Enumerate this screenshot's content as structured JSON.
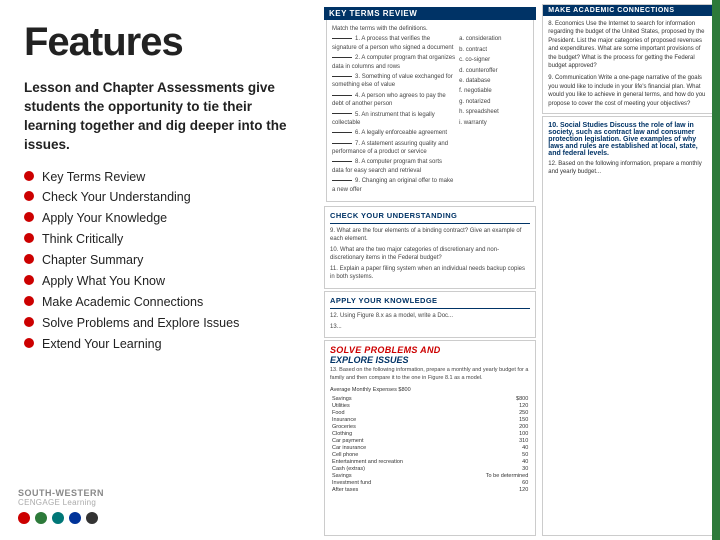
{
  "title": "Features",
  "intro": "Lesson and Chapter Assessments give students the opportunity to tie their learning together and dig deeper into the issues.",
  "bullets": [
    {
      "label": "Key Terms Review"
    },
    {
      "label": "Check Your Understanding"
    },
    {
      "label": "Apply Your Knowledge"
    },
    {
      "label": "Think Critically"
    },
    {
      "label": "Chapter Summary"
    },
    {
      "label": "Apply What You Know"
    },
    {
      "label": "Make Academic Connections"
    },
    {
      "label": "Solve Problems and Explore Issues"
    },
    {
      "label": "Extend Your Learning"
    }
  ],
  "logo": {
    "top": "SOUTH-WESTERN",
    "bottom": "CENGAGE Learning"
  },
  "colors": {
    "red": "#cc0000",
    "green": "#2d7a3a",
    "teal": "#007777",
    "blue": "#003399",
    "dark": "#222222",
    "dots": [
      "#cc0000",
      "#007744",
      "#007777",
      "#003399",
      "#333333"
    ]
  },
  "keyTerms": {
    "header": "KEY TERMS REVIEW",
    "instruction": "Match the terms with the definitions.",
    "items": [
      {
        "num": "1.",
        "text": "A process that verifies the signature of a person who signed a document"
      },
      {
        "num": "2.",
        "text": "A computer program that organizes data in columns and rows"
      },
      {
        "num": "3.",
        "text": "Something of value exchanged for something else of value"
      },
      {
        "num": "4.",
        "text": "A person who agrees to pay the debt of another person"
      },
      {
        "num": "5.",
        "text": "An instrument that is legally collectable"
      },
      {
        "num": "6.",
        "text": "A legally enforceable agreement"
      },
      {
        "num": "7.",
        "text": "A statement assuring quality and performance of a product or service"
      },
      {
        "num": "8.",
        "text": "A computer program that sorts data for easy search and retrieval"
      },
      {
        "num": "9.",
        "text": "Changing an original offer to make a new offer"
      }
    ],
    "answers": [
      "a. consideration",
      "b. contract",
      "c. co-signer",
      "d. counteroffer",
      "e. database",
      "f. negotiable",
      "g. notarized",
      "h. spreadsheet",
      "i. warranty"
    ]
  },
  "checkUnderstanding": {
    "title": "CHECK YOUR UNDERSTANDING",
    "q9": "9. What are the four elements of a binding contract? Give an example of each element.",
    "q10": "10. What are the two major categories of discretionary and non-discretionary items in the Federal budget?",
    "q11": "11. Explain a paper filing system when an individual needs backup copies in both systems."
  },
  "applyKnowledge": {
    "title": "APPLY YOUR KNOWLEDGE",
    "q12": "12. Using Figure 8.x as a model, write a Doc...",
    "q13": "13..."
  },
  "solveProblems": {
    "header": "SOLVE PROBLEMS AND",
    "subheader": "EXPLORE ISSUES",
    "q13_text": "13. Based on the following information, prepare a monthly and yearly budget for a family and then compare it to the one in Figure 8.1 as a model."
  },
  "makeAcademic": {
    "title": "MAKE ACADEMIC CONNECTIONS",
    "q8": "8. Economics Use the Internet to search for information regarding the budget of the United States, proposed by the President. List the major categories of proposed revenues and expenditures. What are some important provisions of the budget? What is the process for getting the Federal budget approved?",
    "q9": "9. Communication Write a one-page narrative of the goals you would like to include in your life's financial plan. What would you like to achieve in general terms, and how do you propose to cover the cost of meeting your objectives?"
  },
  "socialStudies": {
    "title": "10. Social Studies Discuss the role of law in society, such as contract law and consumer protection legislation. Give examples of why laws and rules are established at local, state, and federal levels.",
    "q12": "12. Based on the following information, prepare a monthly and yearly budget..."
  },
  "budgetData": {
    "income_label": "Average Monthly Expenses",
    "income": "$800",
    "rows": [
      {
        "item": "Savings",
        "amount": "$800"
      },
      {
        "item": "Utilities",
        "amount": "120"
      },
      {
        "item": "Food",
        "amount": "250"
      },
      {
        "item": "Insurance",
        "amount": "150"
      },
      {
        "item": "Groceries",
        "amount": "200"
      },
      {
        "item": "Clothing",
        "amount": "100"
      },
      {
        "item": "Car payment",
        "amount": "310"
      },
      {
        "item": "Car insurance",
        "amount": "40"
      },
      {
        "item": "Cell phone",
        "amount": "50"
      },
      {
        "item": "Entertainment and recreation",
        "amount": "40"
      },
      {
        "item": "Cash (extras)",
        "amount": "30"
      }
    ],
    "savings_rows": [
      {
        "item": "Savings",
        "amount": "To be determined"
      },
      {
        "item": "Investment fund",
        "amount": "60"
      },
      {
        "item": "After taxes",
        "amount": "120"
      }
    ]
  }
}
